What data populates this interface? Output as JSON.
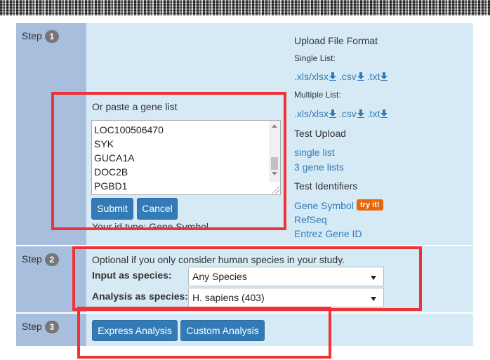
{
  "colors": {
    "accent": "#337ab7",
    "highlight": "#ee3338",
    "try_badge": "#e8650a"
  },
  "steps": [
    {
      "label": "Step",
      "number": "1"
    },
    {
      "label": "Step",
      "number": "2"
    },
    {
      "label": "Step",
      "number": "3"
    }
  ],
  "step1": {
    "paste_label": "Or paste a gene list",
    "genes": [
      "LOC100506470",
      "SYK",
      "GUCA1A",
      "DOC2B",
      "PGBD1"
    ],
    "submit_label": "Submit",
    "cancel_label": "Cancel",
    "id_type_text": "Your id type: Gene Symbol"
  },
  "upload": {
    "title": "Upload File Format",
    "single_list_label": "Single List:",
    "multiple_list_label": "Multiple List:",
    "formats": [
      ".xls/xlsx",
      ".csv",
      ".txt"
    ],
    "download_icon": "download-icon"
  },
  "test_upload": {
    "title": "Test Upload",
    "links": [
      "single list",
      "3 gene lists"
    ]
  },
  "test_identifiers": {
    "title": "Test Identifiers",
    "links": [
      "Gene Symbol",
      "RefSeq",
      "Entrez Gene ID"
    ],
    "try_label": "try it!"
  },
  "step2": {
    "note": "Optional if you only consider human species in your study.",
    "input_label": "Input as species:",
    "input_value": "Any Species",
    "analysis_label": "Analysis as species:",
    "analysis_value": "H. sapiens (403)"
  },
  "step3": {
    "express_label": "Express Analysis",
    "custom_label": "Custom Analysis"
  }
}
